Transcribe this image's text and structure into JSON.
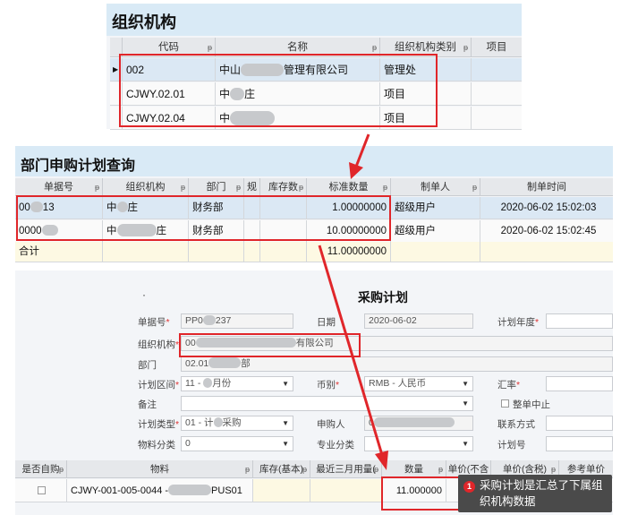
{
  "org_panel": {
    "title": "组织机构",
    "columns": [
      "代码",
      "名称",
      "组织机构类别",
      "项目"
    ],
    "rows": [
      {
        "code": "002",
        "name_a": "中山",
        "name_b": "管理有限公司",
        "category": "管理处"
      },
      {
        "code": "CJWY.02.01",
        "name_a": "中",
        "name_b": "庄",
        "category": "项目"
      },
      {
        "code": "CJWY.02.04",
        "name_a": "中",
        "name_b": "",
        "category": "项目"
      }
    ]
  },
  "query_panel": {
    "title": "部门申购计划查询",
    "columns": [
      "单据号",
      "组织机构",
      "部门",
      "规",
      "库存数",
      "标准数量",
      "制单人",
      "制单时间"
    ],
    "rows": [
      {
        "doc_a": "00",
        "doc_b": "13",
        "org_a": "中",
        "org_b": "庄",
        "dept": "财务部",
        "qty": "1.00000000",
        "maker": "超级用户",
        "time": "2020-06-02 15:02:03"
      },
      {
        "doc_a": "0000",
        "doc_b": "",
        "org_a": "中",
        "org_b": "庄",
        "dept": "财务部",
        "qty": "10.00000000",
        "maker": "超级用户",
        "time": "2020-06-02 15:02:45"
      }
    ],
    "total_label": "合计",
    "total_qty": "11.00000000"
  },
  "plan_form": {
    "dot": "·",
    "title": "采购计划",
    "fields": {
      "doc_no_label": "单据号",
      "doc_no_a": "PP0",
      "doc_no_b": "237",
      "date_label": "日期",
      "date_value": "2020-06-02",
      "plan_year_label": "计划年度",
      "org_label": "组织机构",
      "org_a": "00",
      "org_b": "有限公司",
      "dept_label": "部门",
      "dept_a": "02.01",
      "dept_b": "部",
      "period_label": "计划区间",
      "period_a": "11 - ",
      "period_b": "月份",
      "currency_label": "币别",
      "currency_value": "RMB - 人民币",
      "rate_label": "汇率",
      "note_label": "备注",
      "whole_stop_label": "整单中止",
      "plan_type_label": "计划类型",
      "plan_type_a": "01 - 计",
      "plan_type_b": "采购",
      "buyer_label": "申购人",
      "buyer_value": "0",
      "contact_label": "联系方式",
      "material_cat_label": "物料分类",
      "material_cat_value": "0",
      "category_label": "专业分类",
      "plan_no_label": "计划号"
    },
    "grid_columns": [
      "是否自购",
      "物料",
      "库存(基本)",
      "最近三月用量(",
      "数量",
      "单价(不含",
      "单价(含税)",
      "参考单价"
    ],
    "grid_row": {
      "material_a": "CJWY-001-005-0044 -",
      "material_b": "PUS01",
      "qty": "11.000000"
    }
  },
  "tooltip": {
    "badge": "1",
    "text": "采购计划是汇总了下属组织机构数据"
  },
  "colors": {
    "highlight": "#e0262a",
    "title_bar": "#d9eaf6",
    "selected_row": "#dbe8f4"
  }
}
